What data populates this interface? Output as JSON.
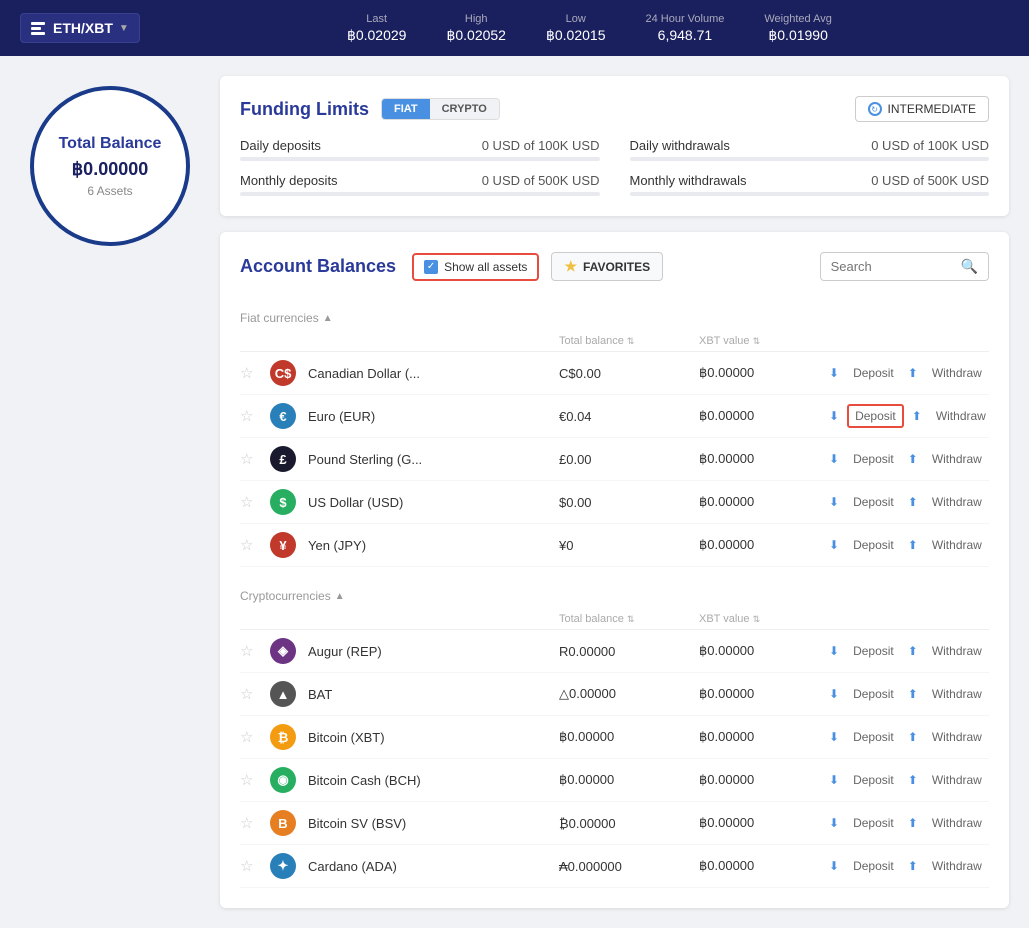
{
  "topbar": {
    "pair": "ETH/XBT",
    "stats": [
      {
        "label": "Last",
        "value": "฿0.02029"
      },
      {
        "label": "High",
        "value": "฿0.02052"
      },
      {
        "label": "Low",
        "value": "฿0.02015"
      },
      {
        "label": "24 Hour Volume",
        "value": "6,948.71"
      },
      {
        "label": "Weighted Avg",
        "value": "฿0.01990"
      }
    ]
  },
  "balance": {
    "title": "Total Balance",
    "amount": "฿0.00000",
    "assets": "6 Assets"
  },
  "funding": {
    "title": "Funding Limits",
    "tabs": [
      "FIAT",
      "CRYPTO"
    ],
    "active_tab": "FIAT",
    "level_btn": "INTERMEDIATE",
    "rows": [
      {
        "label": "Daily deposits",
        "value": "0 USD of 100K USD"
      },
      {
        "label": "Daily withdrawals",
        "value": "0 USD of 100K USD"
      },
      {
        "label": "Monthly deposits",
        "value": "0 USD of 500K USD"
      },
      {
        "label": "Monthly withdrawals",
        "value": "0 USD of 500K USD"
      }
    ]
  },
  "balances": {
    "title": "Account Balances",
    "show_all_label": "Show all assets",
    "favorites_label": "FAVORITES",
    "search_placeholder": "Search",
    "fiat_section_label": "Fiat currencies",
    "crypto_section_label": "Cryptocurrencies",
    "col_total": "Total balance",
    "col_xbt": "XBT value",
    "fiat_rows": [
      {
        "name": "Canadian Dollar (...",
        "symbol": "C$",
        "bg": "#c0392b",
        "icon": "C$",
        "total": "C$0.00",
        "xbt": "฿0.00000",
        "deposit_highlighted": false,
        "withdraw_highlighted": false
      },
      {
        "name": "Euro (EUR)",
        "symbol": "€",
        "bg": "#2980b9",
        "icon": "€",
        "total": "€0.04",
        "xbt": "฿0.00000",
        "deposit_highlighted": true,
        "withdraw_highlighted": false
      },
      {
        "name": "Pound Sterling (G...",
        "symbol": "£",
        "bg": "#1a1a2e",
        "icon": "£",
        "total": "£0.00",
        "xbt": "฿0.00000",
        "deposit_highlighted": false,
        "withdraw_highlighted": false
      },
      {
        "name": "US Dollar (USD)",
        "symbol": "$",
        "bg": "#27ae60",
        "icon": "$",
        "total": "$0.00",
        "xbt": "฿0.00000",
        "deposit_highlighted": false,
        "withdraw_highlighted": false
      },
      {
        "name": "Yen (JPY)",
        "symbol": "¥",
        "bg": "#c0392b",
        "icon": "¥",
        "total": "¥0",
        "xbt": "฿0.00000",
        "deposit_highlighted": false,
        "withdraw_highlighted": false
      }
    ],
    "crypto_rows": [
      {
        "name": "Augur (REP)",
        "symbol": "R",
        "bg": "#6c3483",
        "icon": "◈",
        "total": "R0.00000",
        "xbt": "฿0.00000"
      },
      {
        "name": "BAT",
        "symbol": "▲",
        "bg": "#555",
        "icon": "▲",
        "total": "△0.00000",
        "xbt": "฿0.00000"
      },
      {
        "name": "Bitcoin (XBT)",
        "symbol": "₿",
        "bg": "#f39c12",
        "icon": "₿",
        "total": "฿0.00000",
        "xbt": "฿0.00000"
      },
      {
        "name": "Bitcoin Cash (BCH)",
        "symbol": "Ƀ",
        "bg": "#27ae60",
        "icon": "◉",
        "total": "฿0.00000",
        "xbt": "฿0.00000"
      },
      {
        "name": "Bitcoin SV (BSV)",
        "symbol": "B",
        "bg": "#e67e22",
        "icon": "B",
        "total": "₿0.00000",
        "xbt": "฿0.00000"
      },
      {
        "name": "Cardano (ADA)",
        "symbol": "A",
        "bg": "#2980b9",
        "icon": "✦",
        "total": "₳0.000000",
        "xbt": "฿0.00000"
      }
    ],
    "deposit_label": "Deposit",
    "withdraw_label": "Withdraw"
  }
}
